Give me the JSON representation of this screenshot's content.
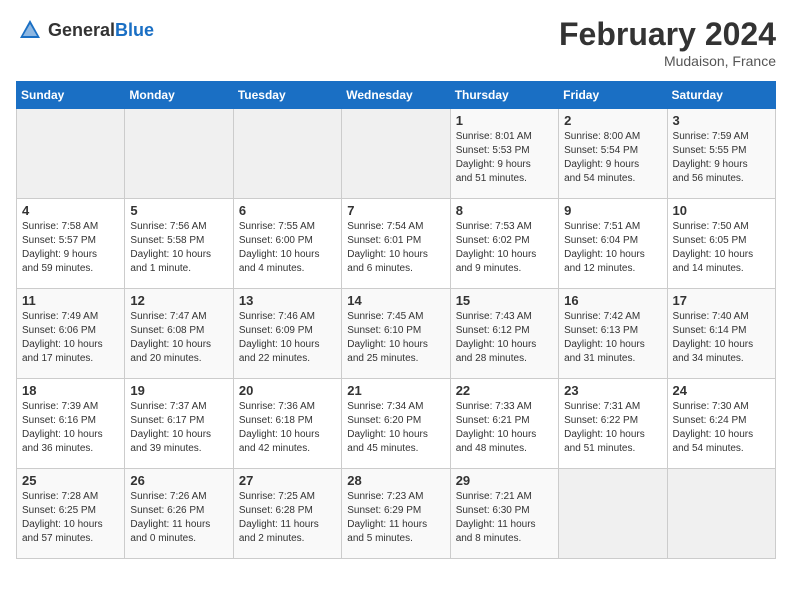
{
  "header": {
    "logo_general": "General",
    "logo_blue": "Blue",
    "title": "February 2024",
    "location": "Mudaison, France"
  },
  "calendar": {
    "days_of_week": [
      "Sunday",
      "Monday",
      "Tuesday",
      "Wednesday",
      "Thursday",
      "Friday",
      "Saturday"
    ],
    "weeks": [
      [
        {
          "day": "",
          "info": ""
        },
        {
          "day": "",
          "info": ""
        },
        {
          "day": "",
          "info": ""
        },
        {
          "day": "",
          "info": ""
        },
        {
          "day": "1",
          "info": "Sunrise: 8:01 AM\nSunset: 5:53 PM\nDaylight: 9 hours\nand 51 minutes."
        },
        {
          "day": "2",
          "info": "Sunrise: 8:00 AM\nSunset: 5:54 PM\nDaylight: 9 hours\nand 54 minutes."
        },
        {
          "day": "3",
          "info": "Sunrise: 7:59 AM\nSunset: 5:55 PM\nDaylight: 9 hours\nand 56 minutes."
        }
      ],
      [
        {
          "day": "4",
          "info": "Sunrise: 7:58 AM\nSunset: 5:57 PM\nDaylight: 9 hours\nand 59 minutes."
        },
        {
          "day": "5",
          "info": "Sunrise: 7:56 AM\nSunset: 5:58 PM\nDaylight: 10 hours\nand 1 minute."
        },
        {
          "day": "6",
          "info": "Sunrise: 7:55 AM\nSunset: 6:00 PM\nDaylight: 10 hours\nand 4 minutes."
        },
        {
          "day": "7",
          "info": "Sunrise: 7:54 AM\nSunset: 6:01 PM\nDaylight: 10 hours\nand 6 minutes."
        },
        {
          "day": "8",
          "info": "Sunrise: 7:53 AM\nSunset: 6:02 PM\nDaylight: 10 hours\nand 9 minutes."
        },
        {
          "day": "9",
          "info": "Sunrise: 7:51 AM\nSunset: 6:04 PM\nDaylight: 10 hours\nand 12 minutes."
        },
        {
          "day": "10",
          "info": "Sunrise: 7:50 AM\nSunset: 6:05 PM\nDaylight: 10 hours\nand 14 minutes."
        }
      ],
      [
        {
          "day": "11",
          "info": "Sunrise: 7:49 AM\nSunset: 6:06 PM\nDaylight: 10 hours\nand 17 minutes."
        },
        {
          "day": "12",
          "info": "Sunrise: 7:47 AM\nSunset: 6:08 PM\nDaylight: 10 hours\nand 20 minutes."
        },
        {
          "day": "13",
          "info": "Sunrise: 7:46 AM\nSunset: 6:09 PM\nDaylight: 10 hours\nand 22 minutes."
        },
        {
          "day": "14",
          "info": "Sunrise: 7:45 AM\nSunset: 6:10 PM\nDaylight: 10 hours\nand 25 minutes."
        },
        {
          "day": "15",
          "info": "Sunrise: 7:43 AM\nSunset: 6:12 PM\nDaylight: 10 hours\nand 28 minutes."
        },
        {
          "day": "16",
          "info": "Sunrise: 7:42 AM\nSunset: 6:13 PM\nDaylight: 10 hours\nand 31 minutes."
        },
        {
          "day": "17",
          "info": "Sunrise: 7:40 AM\nSunset: 6:14 PM\nDaylight: 10 hours\nand 34 minutes."
        }
      ],
      [
        {
          "day": "18",
          "info": "Sunrise: 7:39 AM\nSunset: 6:16 PM\nDaylight: 10 hours\nand 36 minutes."
        },
        {
          "day": "19",
          "info": "Sunrise: 7:37 AM\nSunset: 6:17 PM\nDaylight: 10 hours\nand 39 minutes."
        },
        {
          "day": "20",
          "info": "Sunrise: 7:36 AM\nSunset: 6:18 PM\nDaylight: 10 hours\nand 42 minutes."
        },
        {
          "day": "21",
          "info": "Sunrise: 7:34 AM\nSunset: 6:20 PM\nDaylight: 10 hours\nand 45 minutes."
        },
        {
          "day": "22",
          "info": "Sunrise: 7:33 AM\nSunset: 6:21 PM\nDaylight: 10 hours\nand 48 minutes."
        },
        {
          "day": "23",
          "info": "Sunrise: 7:31 AM\nSunset: 6:22 PM\nDaylight: 10 hours\nand 51 minutes."
        },
        {
          "day": "24",
          "info": "Sunrise: 7:30 AM\nSunset: 6:24 PM\nDaylight: 10 hours\nand 54 minutes."
        }
      ],
      [
        {
          "day": "25",
          "info": "Sunrise: 7:28 AM\nSunset: 6:25 PM\nDaylight: 10 hours\nand 57 minutes."
        },
        {
          "day": "26",
          "info": "Sunrise: 7:26 AM\nSunset: 6:26 PM\nDaylight: 11 hours\nand 0 minutes."
        },
        {
          "day": "27",
          "info": "Sunrise: 7:25 AM\nSunset: 6:28 PM\nDaylight: 11 hours\nand 2 minutes."
        },
        {
          "day": "28",
          "info": "Sunrise: 7:23 AM\nSunset: 6:29 PM\nDaylight: 11 hours\nand 5 minutes."
        },
        {
          "day": "29",
          "info": "Sunrise: 7:21 AM\nSunset: 6:30 PM\nDaylight: 11 hours\nand 8 minutes."
        },
        {
          "day": "",
          "info": ""
        },
        {
          "day": "",
          "info": ""
        }
      ]
    ]
  }
}
